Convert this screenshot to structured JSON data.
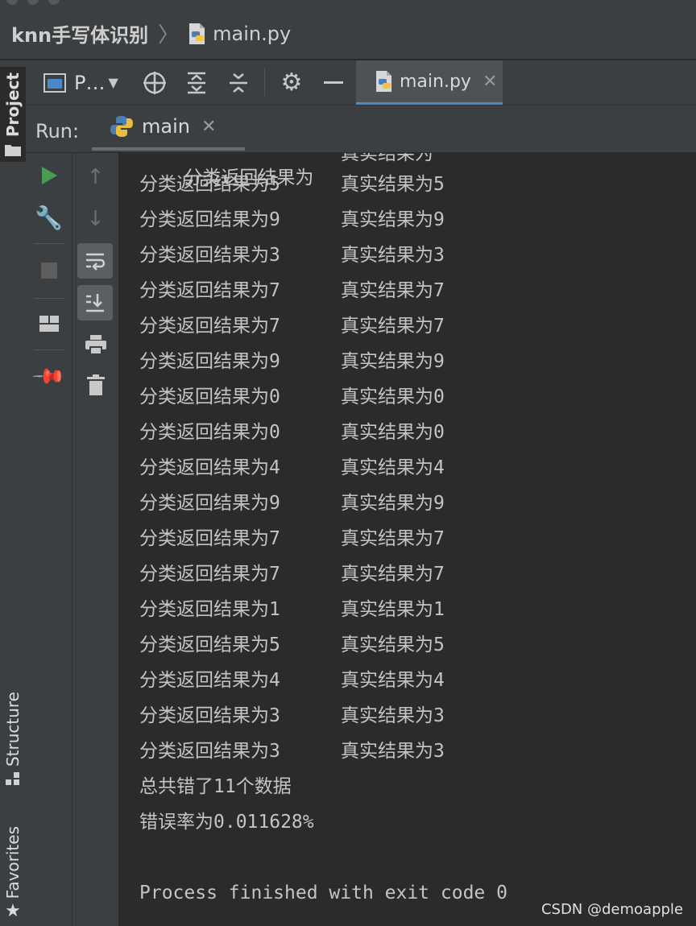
{
  "breadcrumb": {
    "project": "knn手写体识别",
    "file": "main.py"
  },
  "sidebar": {
    "project_tab": "Project",
    "structure_tab": "Structure",
    "favorites_tab": "Favorites"
  },
  "toolbar": {
    "project_dropdown": "P…"
  },
  "editor": {
    "active_tab": "main.py"
  },
  "run_panel": {
    "label": "Run:",
    "tab": "main"
  },
  "console": {
    "partial_first_line": [
      "分类返回结果为",
      "真实结果为"
    ],
    "lines": [
      [
        "分类返回结果为5",
        "真实结果为5"
      ],
      [
        "分类返回结果为9",
        "真实结果为9"
      ],
      [
        "分类返回结果为3",
        "真实结果为3"
      ],
      [
        "分类返回结果为7",
        "真实结果为7"
      ],
      [
        "分类返回结果为7",
        "真实结果为7"
      ],
      [
        "分类返回结果为9",
        "真实结果为9"
      ],
      [
        "分类返回结果为0",
        "真实结果为0"
      ],
      [
        "分类返回结果为0",
        "真实结果为0"
      ],
      [
        "分类返回结果为4",
        "真实结果为4"
      ],
      [
        "分类返回结果为9",
        "真实结果为9"
      ],
      [
        "分类返回结果为7",
        "真实结果为7"
      ],
      [
        "分类返回结果为7",
        "真实结果为7"
      ],
      [
        "分类返回结果为1",
        "真实结果为1"
      ],
      [
        "分类返回结果为5",
        "真实结果为5"
      ],
      [
        "分类返回结果为4",
        "真实结果为4"
      ],
      [
        "分类返回结果为3",
        "真实结果为3"
      ],
      [
        "分类返回结果为3",
        "真实结果为3"
      ]
    ],
    "summary_errors": "总共错了11个数据",
    "summary_rate": "错误率为0.011628%",
    "exit_message": "Process finished with exit code 0"
  },
  "watermark": "CSDN @demoapple",
  "colors": {
    "run_green": "#499c54",
    "tab_underline": "#4a88c7",
    "python_blue": "#4a7fb5",
    "python_yellow": "#f3c53c"
  }
}
